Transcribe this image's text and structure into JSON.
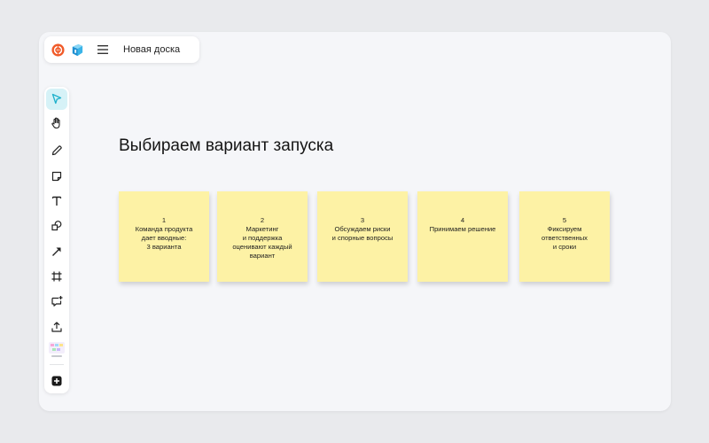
{
  "header": {
    "board_title": "Новая доска"
  },
  "icons": {
    "logo_primary": "orange-circle-logo-icon",
    "logo_secondary": "blue-cube-logo-icon",
    "menu": "hamburger-menu-icon"
  },
  "toolbar": {
    "tools": [
      {
        "id": "select",
        "icon": "pointer-arrow-icon",
        "active": true
      },
      {
        "id": "hand",
        "icon": "hand-icon",
        "active": false
      },
      {
        "id": "pen",
        "icon": "pencil-icon",
        "active": false
      },
      {
        "id": "sticky",
        "icon": "sticky-note-icon",
        "active": false
      },
      {
        "id": "text",
        "icon": "text-icon",
        "active": false
      },
      {
        "id": "shapes",
        "icon": "shapes-icon",
        "active": false
      },
      {
        "id": "connector",
        "icon": "arrow-icon",
        "active": false
      },
      {
        "id": "frame",
        "icon": "frame-icon",
        "active": false
      },
      {
        "id": "comment",
        "icon": "comment-add-icon",
        "active": false
      },
      {
        "id": "upload",
        "icon": "upload-icon",
        "active": false
      },
      {
        "id": "templates",
        "icon": "templates-thumbnail-icon",
        "active": false
      },
      {
        "id": "add",
        "icon": "plus-square-icon",
        "active": false
      }
    ]
  },
  "canvas": {
    "title": "Выбираем вариант запуска",
    "sticky_color": "#fdf2a5",
    "stickies": [
      {
        "number": "1",
        "lines": [
          "Команда продукта",
          "дает вводные:",
          "3 варианта"
        ]
      },
      {
        "number": "2",
        "lines": [
          "Маркетинг",
          "и поддержка",
          "оценивают каждый",
          "вариант"
        ]
      },
      {
        "number": "3",
        "lines": [
          "Обсуждаем риски",
          "и спорные вопросы"
        ]
      },
      {
        "number": "4",
        "lines": [
          "Принимаем решение"
        ]
      },
      {
        "number": "5",
        "lines": [
          "Фиксируем",
          "ответственных",
          "и сроки"
        ]
      }
    ]
  },
  "colors": {
    "accent": "#1fb1cc",
    "logo_orange": "#f05a28",
    "background": "#e9eaed",
    "canvas": "#f5f6f9"
  }
}
